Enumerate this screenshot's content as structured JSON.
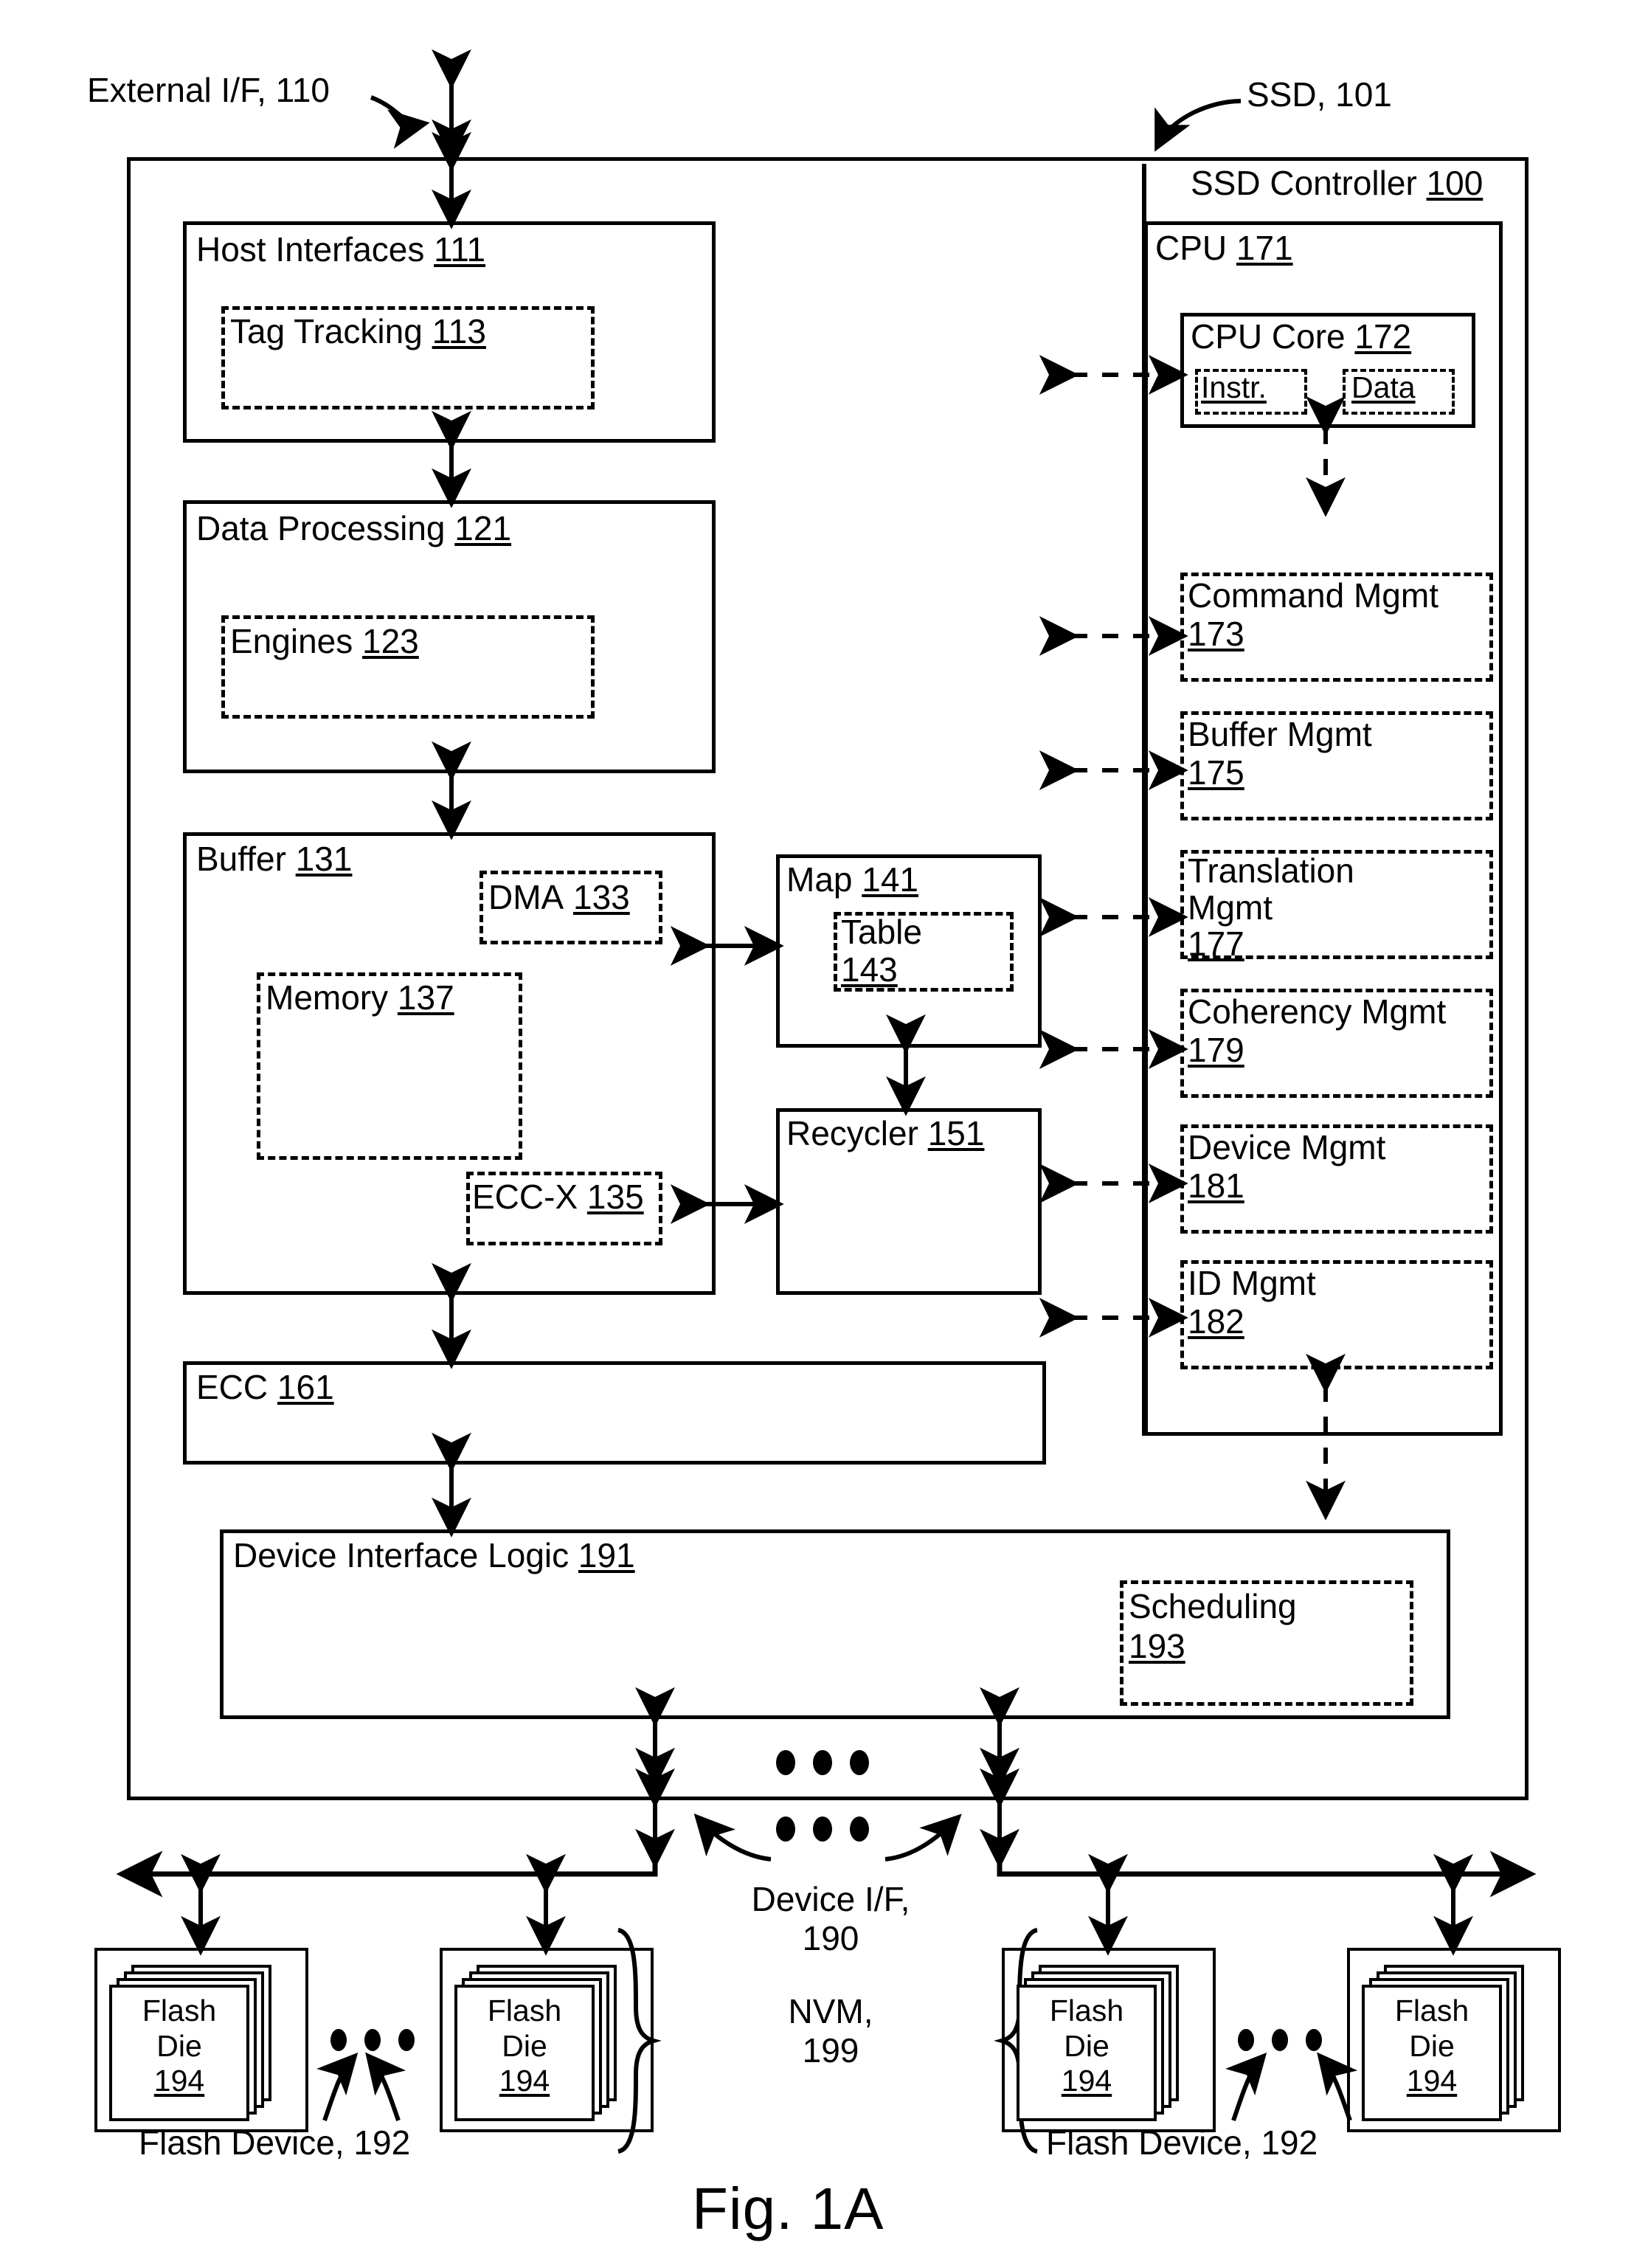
{
  "figure": {
    "caption": "Fig. 1A"
  },
  "annotations": {
    "external_if": "External I/F, 110",
    "ssd": "SSD, 101",
    "device_if_line1": "Device I/F,",
    "device_if_line2": "190",
    "nvm_line1": "NVM,",
    "nvm_line2": "199",
    "flash_device_left": "Flash Device, 192",
    "flash_device_right": "Flash Device, 192"
  },
  "controller": {
    "title_text": "SSD Controller",
    "title_num": "100"
  },
  "left_column": {
    "host_interfaces": {
      "label": "Host Interfaces",
      "num": "111",
      "sub": {
        "label": "Tag Tracking",
        "num": "113"
      }
    },
    "data_processing": {
      "label": "Data Processing",
      "num": "121",
      "sub": {
        "label": "Engines",
        "num": "123"
      }
    },
    "buffer": {
      "label": "Buffer",
      "num": "131",
      "dma": {
        "label": "DMA",
        "num": "133"
      },
      "memory": {
        "label": "Memory",
        "num": "137"
      },
      "eccx": {
        "label": "ECC-X",
        "num": "135"
      }
    },
    "ecc": {
      "label": "ECC",
      "num": "161"
    },
    "device_interface_logic": {
      "label": "Device Interface Logic",
      "num": "191",
      "sub": {
        "label": "Scheduling",
        "num": "193"
      }
    }
  },
  "middle_column": {
    "map": {
      "label": "Map",
      "num": "141",
      "sub": {
        "label": "Table",
        "num": "143"
      }
    },
    "recycler": {
      "label": "Recycler",
      "num": "151"
    }
  },
  "cpu": {
    "label": "CPU",
    "num": "171",
    "core": {
      "label": "CPU Core",
      "num": "172",
      "instr": "Instr.",
      "data": "Data"
    },
    "blocks": [
      {
        "label_line1": "Command Mgmt",
        "label_line2": "",
        "num": "173"
      },
      {
        "label_line1": "Buffer Mgmt",
        "label_line2": "",
        "num": "175"
      },
      {
        "label_line1": "Translation",
        "label_line2": "Mgmt",
        "num": "177"
      },
      {
        "label_line1": "Coherency Mgmt",
        "label_line2": "",
        "num": "179"
      },
      {
        "label_line1": "Device Mgmt",
        "label_line2": "",
        "num": "181"
      },
      {
        "label_line1": "ID Mgmt",
        "label_line2": "",
        "num": "182"
      }
    ]
  },
  "flash": {
    "dies": [
      {
        "line1": "Flash",
        "line2": "Die",
        "num": "194"
      },
      {
        "line1": "Flash",
        "line2": "Die",
        "num": "194"
      },
      {
        "line1": "Flash",
        "line2": "Die",
        "num": "194"
      },
      {
        "line1": "Flash",
        "line2": "Die",
        "num": "194"
      }
    ]
  },
  "colors": {
    "ink": "#000000",
    "paper": "#ffffff"
  }
}
